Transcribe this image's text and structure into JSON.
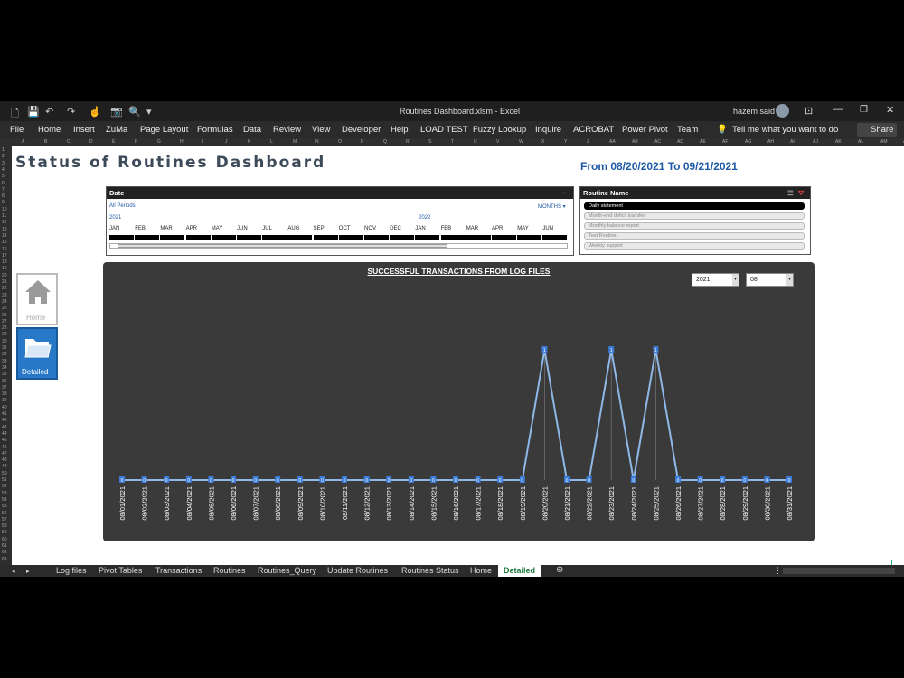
{
  "window": {
    "title": "Routines Dashboard.xlsm  -  Excel",
    "user": "hazem said",
    "share_label": "Share"
  },
  "ribbon": {
    "tabs": [
      "File",
      "Home",
      "Insert",
      "ZuMa",
      "Page Layout",
      "Formulas",
      "Data",
      "Review",
      "View",
      "Developer",
      "Help",
      "LOAD TEST",
      "Fuzzy Lookup",
      "Inquire",
      "ACROBAT",
      "Power Pivot",
      "Team"
    ],
    "tell_me": "Tell me what you want to do"
  },
  "columns": [
    "A",
    "B",
    "C",
    "D",
    "E",
    "F",
    "G",
    "H",
    "I",
    "J",
    "K",
    "L",
    "M",
    "N",
    "O",
    "P",
    "Q",
    "R",
    "S",
    "T",
    "U",
    "V",
    "W",
    "X",
    "Y",
    "Z",
    "AA",
    "AB",
    "AC",
    "AD",
    "AE",
    "AF",
    "AG",
    "AH",
    "AI",
    "AJ",
    "AK",
    "AL",
    "AM",
    "AN"
  ],
  "dashboard": {
    "title": "Status of Routines Dashboard",
    "date_range": "From 08/20/2021 To 09/21/2021"
  },
  "date_slicer": {
    "header": "Date",
    "all_periods": "All Periods",
    "level": "MONTHS",
    "year1": "2021",
    "year2": "2022",
    "months": [
      "JAN",
      "FEB",
      "MAR",
      "APR",
      "MAY",
      "JUN",
      "JUL",
      "AUG",
      "SEP",
      "OCT",
      "NOV",
      "DEC",
      "JAN",
      "FEB",
      "MAR",
      "APR",
      "MAY",
      "JUN"
    ]
  },
  "routine_slicer": {
    "header": "Routine Name",
    "items": [
      {
        "label": "Daily statement",
        "selected": true
      },
      {
        "label": "Month-end deficit transfer",
        "selected": false
      },
      {
        "label": "Monthly balance report",
        "selected": false
      },
      {
        "label": "Test Routine",
        "selected": false
      },
      {
        "label": "Weekly support",
        "selected": false
      }
    ]
  },
  "nav": {
    "home_label": "Home",
    "detailed_label": "Detailed"
  },
  "filters": {
    "year": "2021",
    "month": "08"
  },
  "chart_data": {
    "type": "line",
    "title": "SUCCESSFUL TRANSACTIONS FROM LOG FILES",
    "x": [
      "08/01/2021",
      "08/02/2021",
      "08/03/2021",
      "08/04/2021",
      "08/05/2021",
      "08/06/2021",
      "08/07/2021",
      "08/08/2021",
      "08/09/2021",
      "08/10/2021",
      "08/11/2021",
      "08/12/2021",
      "08/13/2021",
      "08/14/2021",
      "08/15/2021",
      "08/16/2021",
      "08/17/2021",
      "08/18/2021",
      "08/19/2021",
      "08/20/2021",
      "08/21/2021",
      "08/22/2021",
      "08/23/2021",
      "08/24/2021",
      "08/25/2021",
      "08/26/2021",
      "08/27/2021",
      "08/28/2021",
      "08/29/2021",
      "08/30/2021",
      "08/31/2021"
    ],
    "values": [
      0,
      0,
      0,
      0,
      0,
      0,
      0,
      0,
      0,
      0,
      0,
      0,
      0,
      0,
      0,
      0,
      0,
      0,
      0,
      1,
      0,
      0,
      1,
      0,
      1,
      0,
      0,
      0,
      0,
      0,
      0
    ],
    "ylim": [
      0,
      1
    ],
    "line_color": "#8fb8e8",
    "label_color": "#3a7bd5"
  },
  "sheet_tabs": {
    "tabs": [
      "Log files",
      "Pivot Tables",
      "Transactions",
      "Routines",
      "Routines_Query",
      "Update Routines",
      "Routines Status",
      "Home",
      "Detailed"
    ],
    "active": "Detailed"
  },
  "colors": {
    "accent": "#1f5aa6",
    "nav_active": "#2878c8"
  }
}
